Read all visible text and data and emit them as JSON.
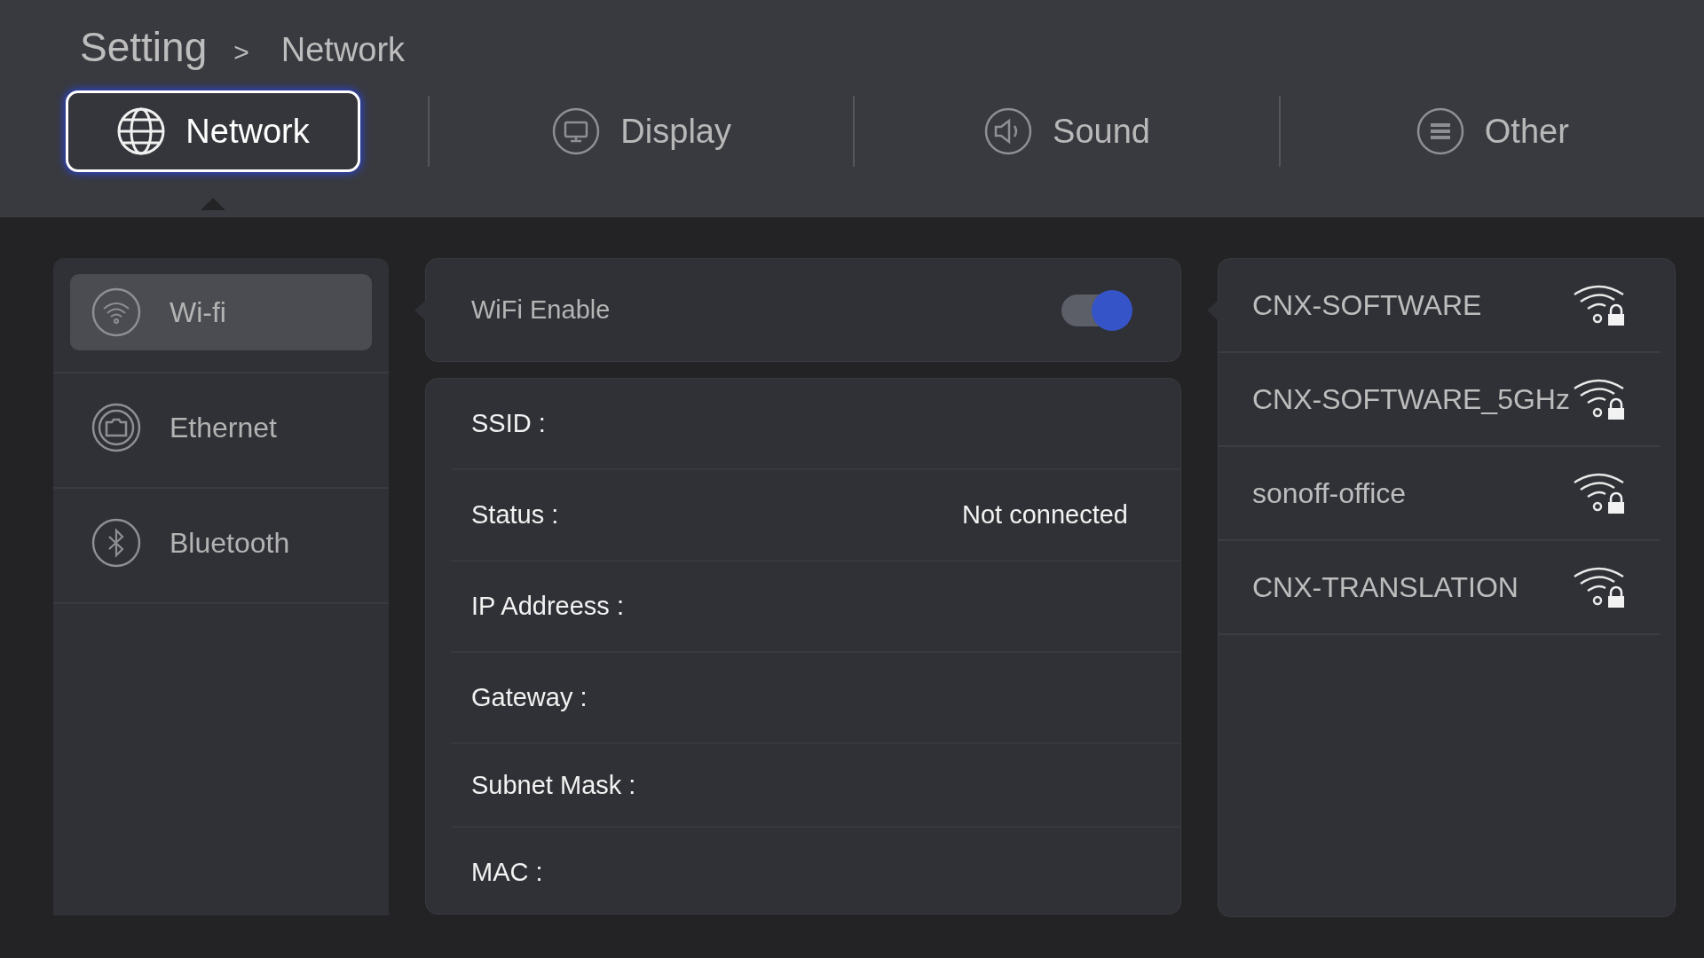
{
  "breadcrumb": {
    "root": "Setting",
    "separator": ">",
    "current": "Network"
  },
  "tabs": [
    {
      "label": "Network",
      "kind": "globe",
      "selected": true
    },
    {
      "label": "Display",
      "kind": "display",
      "selected": false
    },
    {
      "label": "Sound",
      "kind": "sound",
      "selected": false
    },
    {
      "label": "Other",
      "kind": "menu",
      "selected": false
    }
  ],
  "sidebar": {
    "items": [
      {
        "label": "Wi-fi",
        "kind": "wifi",
        "selected": true
      },
      {
        "label": "Ethernet",
        "kind": "ethernet",
        "selected": false
      },
      {
        "label": "Bluetooth",
        "kind": "bluetooth",
        "selected": false
      }
    ]
  },
  "wifi_enable": {
    "label": "WiFi Enable",
    "on": true
  },
  "details": [
    {
      "label": "SSID :"
    },
    {
      "label": "Status :",
      "value": "Not connected"
    },
    {
      "label": "IP Addreess :"
    },
    {
      "label": "Gateway :"
    },
    {
      "label": "Subnet Mask :"
    },
    {
      "label": "MAC :"
    }
  ],
  "networks": [
    {
      "name": "CNX-SOFTWARE",
      "secured": true
    },
    {
      "name": "CNX-SOFTWARE_5GHz",
      "secured": true
    },
    {
      "name": "sonoff-office",
      "secured": true
    },
    {
      "name": "CNX-TRANSLATION",
      "secured": true
    }
  ]
}
